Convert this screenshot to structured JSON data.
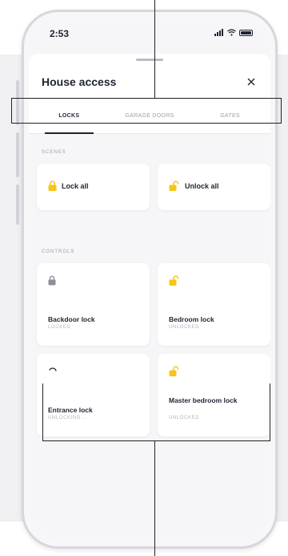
{
  "status_bar": {
    "time": "2:53"
  },
  "sheet": {
    "title": "House access",
    "tabs": [
      {
        "label": "LOCKS",
        "active": true
      },
      {
        "label": "GARAGE DOORS",
        "active": false
      },
      {
        "label": "GATES",
        "active": false
      }
    ]
  },
  "scenes": {
    "section_label": "SCENES",
    "items": [
      {
        "label": "Lock all",
        "icon": "padlock-closed-icon"
      },
      {
        "label": "Unlock all",
        "icon": "padlock-open-icon"
      }
    ]
  },
  "controls": {
    "section_label": "CONTROLS",
    "items": [
      {
        "name": "Backdoor lock",
        "status": "LOCKED",
        "icon": "padlock-closed-icon"
      },
      {
        "name": "Bedroom lock",
        "status": "UNLOCKED",
        "icon": "padlock-open-icon"
      },
      {
        "name": "Entrance lock",
        "status": "UNLOCKING...",
        "icon": "loading-spinner-icon"
      },
      {
        "name": "Master bedroom lock",
        "status": "UNLOCKED",
        "icon": "padlock-open-icon"
      }
    ]
  },
  "colors": {
    "accent_yellow": "#f5c518",
    "locked_gray": "#8a8f9b",
    "text_dark": "#1f2432",
    "text_muted": "#9aa0ab"
  }
}
